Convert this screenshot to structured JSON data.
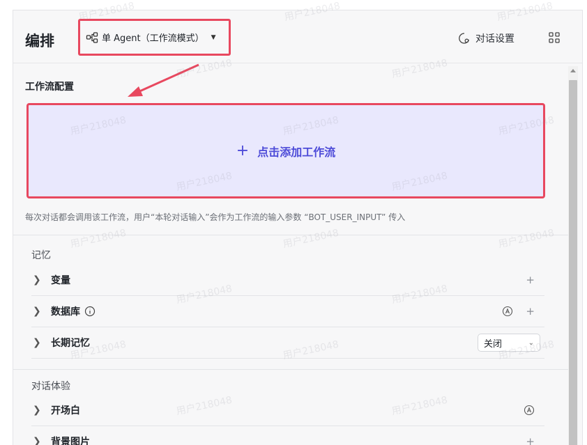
{
  "header": {
    "title": "编排",
    "mode_label": "单 Agent（工作流模式）",
    "chat_settings_label": "对话设置"
  },
  "workflow": {
    "section_title": "工作流配置",
    "add_label": "点击添加工作流",
    "hint": "每次对话都会调用该工作流，用户“本轮对话输入”会作为工作流的输入参数 “BOT_USER_INPUT” 传入"
  },
  "memory": {
    "title": "记忆",
    "items": [
      {
        "label": "变量"
      },
      {
        "label": "数据库"
      },
      {
        "label": "长期记忆",
        "select_value": "关闭"
      }
    ]
  },
  "experience": {
    "title": "对话体验",
    "items": [
      {
        "label": "开场白"
      },
      {
        "label": "背景图片"
      }
    ]
  },
  "watermark_text": "用户218048",
  "colors": {
    "highlight": "#e8485f",
    "accent": "#4d4bd8",
    "add_bg": "#e9e8fd"
  }
}
